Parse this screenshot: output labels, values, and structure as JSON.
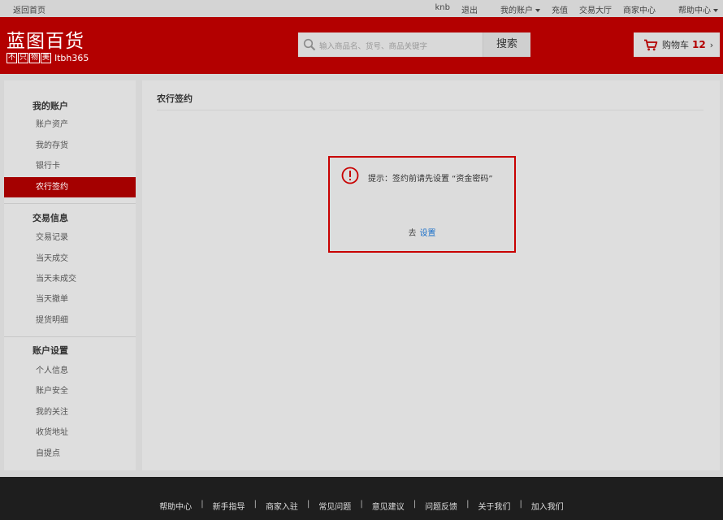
{
  "topbar": {
    "home": "返回首页",
    "user": "knb",
    "logout": "退出",
    "my_account": "我的账户",
    "recharge": "充值",
    "trade_hall": "交易大厅",
    "merchant_center": "商家中心",
    "help_center": "帮助中心"
  },
  "header": {
    "logo_name": "蓝图百货",
    "logo_slogan": [
      "不",
      "只",
      "物",
      "美"
    ],
    "logo_domain": "ltbh365",
    "search_placeholder": "输入商品名、货号、商品关键字",
    "search_button": "搜索",
    "cart_label": "购物车",
    "cart_count": "12",
    "cart_arrow": "›"
  },
  "sidebar": {
    "groups": [
      {
        "title": "我的账户",
        "items": [
          "账户资产",
          "我的存货",
          "银行卡",
          "农行签约"
        ]
      },
      {
        "title": "交易信息",
        "items": [
          "交易记录",
          "当天成交",
          "当天未成交",
          "当天撤单",
          "提货明细"
        ]
      },
      {
        "title": "账户设置",
        "items": [
          "个人信息",
          "账户安全",
          "我的关注",
          "收货地址",
          "自提点"
        ]
      }
    ],
    "active_item": "农行签约"
  },
  "main": {
    "title": "农行签约",
    "dialog": {
      "message": "提示：签约前请先设置 “资金密码”",
      "action_prefix": "去",
      "action_link": "设置"
    }
  },
  "footer": {
    "links": [
      "帮助中心",
      "新手指导",
      "商家入驻",
      "常见问题",
      "意见建议",
      "问题反馈",
      "关于我们",
      "加入我们"
    ],
    "separator": "|"
  },
  "colors": {
    "brand_red": "#b30000",
    "active_red": "#a40000",
    "dialog_border": "#c80000",
    "link_blue": "#1a6fc9",
    "footer_bg": "#1e1e1e"
  }
}
